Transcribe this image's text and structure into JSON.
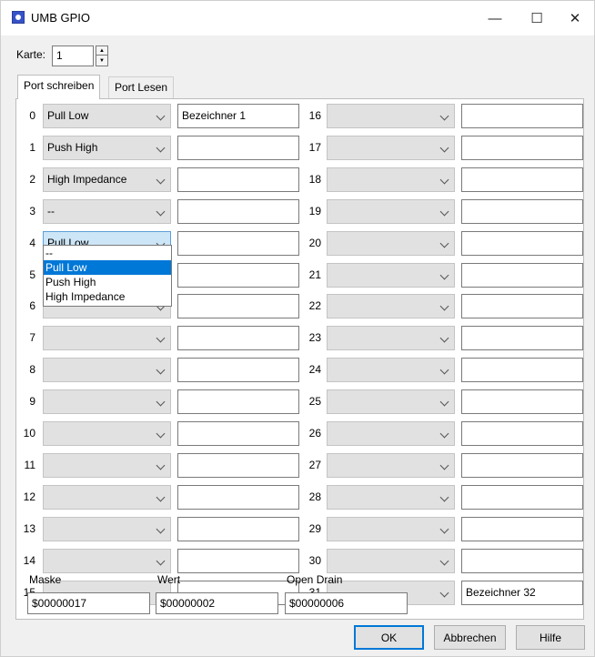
{
  "window": {
    "title": "UMB GPIO"
  },
  "titlebar": {
    "minimize": "—",
    "maximize": "☐",
    "close": "✕"
  },
  "karte": {
    "label": "Karte:",
    "value": "1"
  },
  "tabs": [
    {
      "label": "Port schreiben",
      "active": true
    },
    {
      "label": "Port Lesen",
      "active": false
    }
  ],
  "left_ports": [
    {
      "num": "0",
      "mode": "Pull Low",
      "name": "Bezeichner 1"
    },
    {
      "num": "1",
      "mode": "Push High",
      "name": ""
    },
    {
      "num": "2",
      "mode": "High Impedance",
      "name": ""
    },
    {
      "num": "3",
      "mode": "--",
      "name": ""
    },
    {
      "num": "4",
      "mode": "Pull Low",
      "name": ""
    },
    {
      "num": "5",
      "mode": "",
      "name": ""
    },
    {
      "num": "6",
      "mode": "",
      "name": ""
    },
    {
      "num": "7",
      "mode": "",
      "name": ""
    },
    {
      "num": "8",
      "mode": "",
      "name": ""
    },
    {
      "num": "9",
      "mode": "",
      "name": ""
    },
    {
      "num": "10",
      "mode": "",
      "name": ""
    },
    {
      "num": "11",
      "mode": "",
      "name": ""
    },
    {
      "num": "12",
      "mode": "",
      "name": ""
    },
    {
      "num": "13",
      "mode": "",
      "name": ""
    },
    {
      "num": "14",
      "mode": "",
      "name": ""
    },
    {
      "num": "15",
      "mode": "",
      "name": ""
    }
  ],
  "right_ports": [
    {
      "num": "16",
      "mode": "",
      "name": ""
    },
    {
      "num": "17",
      "mode": "",
      "name": ""
    },
    {
      "num": "18",
      "mode": "",
      "name": ""
    },
    {
      "num": "19",
      "mode": "",
      "name": ""
    },
    {
      "num": "20",
      "mode": "",
      "name": ""
    },
    {
      "num": "21",
      "mode": "",
      "name": ""
    },
    {
      "num": "22",
      "mode": "",
      "name": ""
    },
    {
      "num": "23",
      "mode": "",
      "name": ""
    },
    {
      "num": "24",
      "mode": "",
      "name": ""
    },
    {
      "num": "25",
      "mode": "",
      "name": ""
    },
    {
      "num": "26",
      "mode": "",
      "name": ""
    },
    {
      "num": "27",
      "mode": "",
      "name": ""
    },
    {
      "num": "28",
      "mode": "",
      "name": ""
    },
    {
      "num": "29",
      "mode": "",
      "name": ""
    },
    {
      "num": "30",
      "mode": "",
      "name": ""
    },
    {
      "num": "31",
      "mode": "",
      "name": "Bezeichner 32"
    }
  ],
  "dropdown": {
    "options": [
      "--",
      "Pull Low",
      "Push High",
      "High Impedance"
    ],
    "selected_index": 1
  },
  "fields": {
    "maske_label": "Maske",
    "maske_value": "$00000017",
    "wert_label": "Wert",
    "wert_value": "$00000002",
    "open_drain_label": "Open Drain",
    "open_drain_value": "$00000006"
  },
  "buttons": {
    "ok": "OK",
    "cancel": "Abbrechen",
    "help": "Hilfe"
  },
  "colors": {
    "selection": "#0078d7",
    "combo_highlight": "#cde6f7",
    "combo_disabled": "#e1e1e1"
  }
}
